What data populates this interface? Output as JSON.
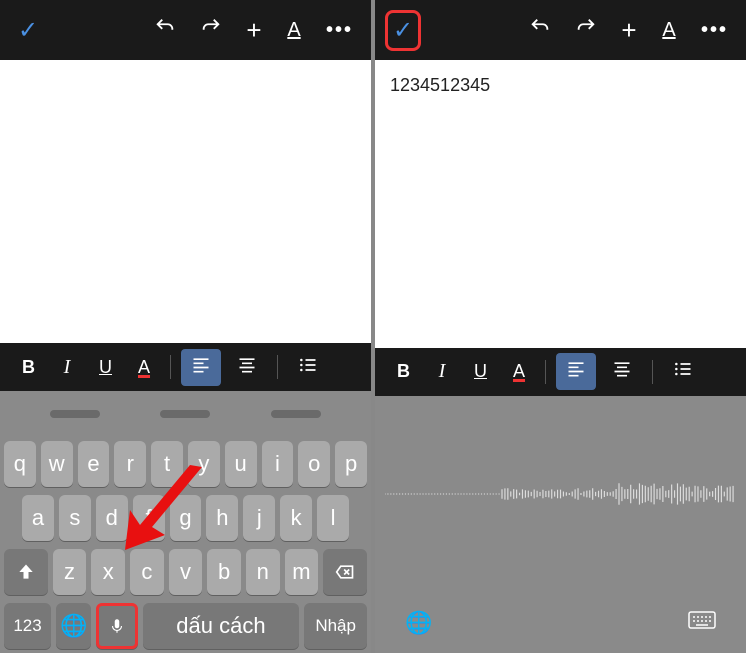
{
  "left": {
    "doc_text": "",
    "keyboard": {
      "row1": [
        "q",
        "w",
        "e",
        "r",
        "t",
        "y",
        "u",
        "i",
        "o",
        "p"
      ],
      "row2": [
        "a",
        "s",
        "d",
        "f",
        "g",
        "h",
        "j",
        "k",
        "l"
      ],
      "row3": [
        "z",
        "x",
        "c",
        "v",
        "b",
        "n",
        "m"
      ],
      "num_key": "123",
      "space_label": "dấu cách",
      "enter_label": "Nhập"
    }
  },
  "right": {
    "doc_text": "1234512345"
  },
  "format": {
    "bold": "B",
    "italic": "I",
    "underline": "U",
    "textcolor": "A"
  }
}
